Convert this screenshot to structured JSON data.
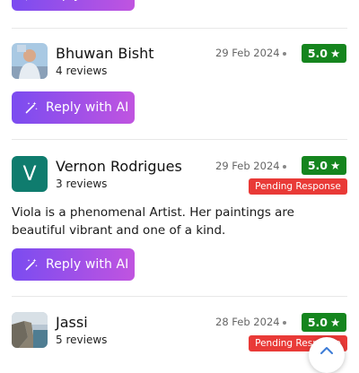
{
  "colors": {
    "rating_bg": "#15851e",
    "pending_bg": "#e93a37",
    "ai_gradient_start": "#7b4cf0",
    "ai_gradient_end": "#c054e0",
    "avatar_initial_bg": "#0f7c6e"
  },
  "ai_button_label": "Reply with AI",
  "reviews": [
    {
      "name": "Bhuwan Bisht",
      "review_count": "4 reviews",
      "date": "29 Feb 2024",
      "rating": "5.0",
      "avatar": "photo"
    },
    {
      "name": "Vernon Rodrigues",
      "review_count": "3 reviews",
      "date": "29 Feb 2024",
      "rating": "5.0",
      "status": "Pending Response",
      "avatar_initial": "V",
      "text": "Viola is a phenomenal Artist. Her paintings are beautiful vibrant and one of a kind."
    },
    {
      "name": "Jassi",
      "review_count": "5 reviews",
      "date": "28 Feb 2024",
      "rating": "5.0",
      "status": "Pending Response",
      "avatar": "photo"
    }
  ],
  "icons": {
    "rating": "star-icon",
    "ai": "magic-wand-icon",
    "scroll": "chevron-up-icon"
  }
}
